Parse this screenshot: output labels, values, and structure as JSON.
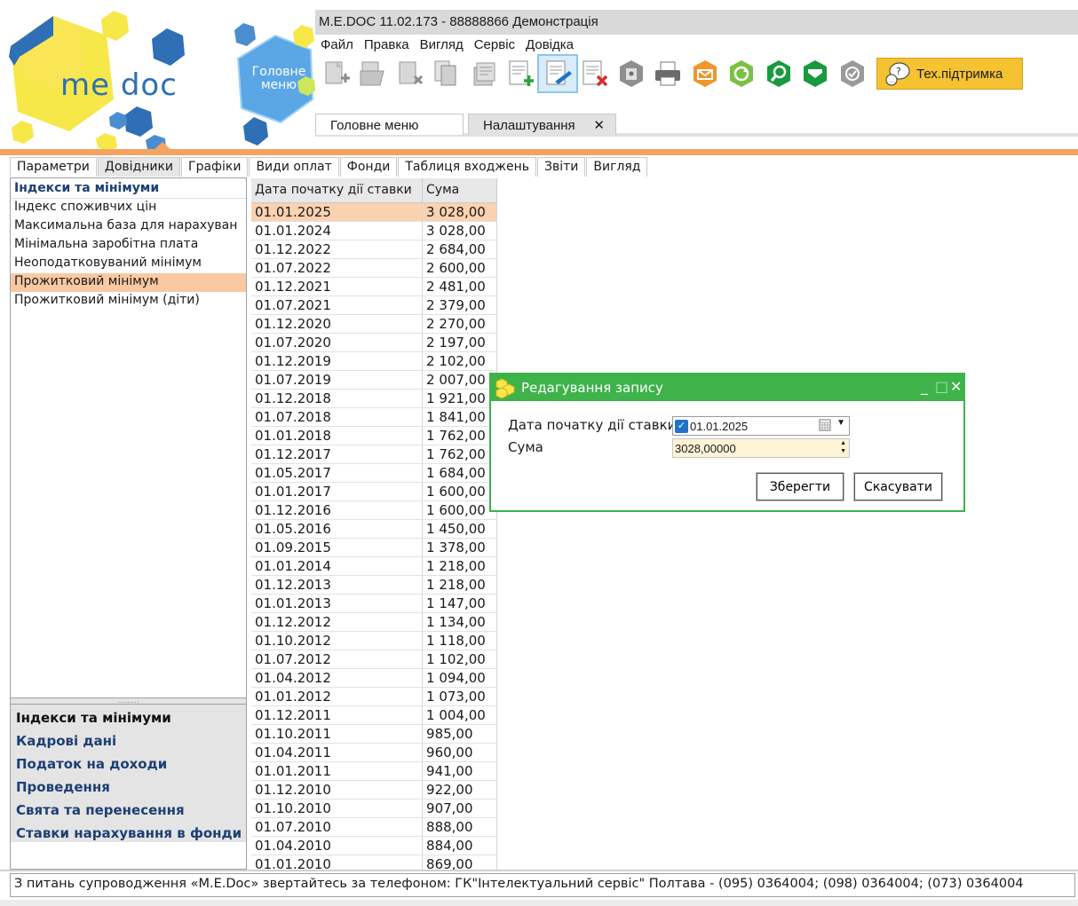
{
  "app": {
    "title": "M.E.DOC 11.02.173  - 88888866 Демонстрація",
    "logo_text": "me doc",
    "main_menu_hex_label": "Головне меню"
  },
  "menu": [
    "Файл",
    "Правка",
    "Вигляд",
    "Сервіс",
    "Довідка"
  ],
  "toolbar": {
    "icons": [
      "new-document-icon",
      "open-document-icon",
      "delete-document-icon",
      "copy-icon",
      "stack-icon",
      "add-record-icon",
      "edit-record-icon",
      "delete-record-icon",
      "archive-icon",
      "print-icon",
      "send-mail-icon",
      "refresh-icon",
      "search-icon",
      "inbox-icon",
      "verify-icon"
    ],
    "support_label": "Тех.підтримка",
    "colors": {
      "support_bg": "#f5c332",
      "active_outline": "#8ec5ea"
    }
  },
  "doc_tabs": {
    "main": "Головне меню",
    "settings": "Налаштування",
    "close_glyph": "✕"
  },
  "ribbon_tabs": [
    "Параметри",
    "Довідники",
    "Графіки",
    "Види оплат",
    "Фонди",
    "Таблиця входжень",
    "Звіти",
    "Вигляд"
  ],
  "left_panel": {
    "header": "Індекси та мінімуми",
    "items": [
      "Індекс споживчих цін",
      "Максимальна база для нарахуван",
      "Мінімальна заробітна плата",
      "Неоподатковуваний мінімум",
      "Прожитковий мінімум",
      "Прожитковий мінімум (діти)"
    ],
    "selected_index": 4,
    "splitter_glyph": "………",
    "nav": [
      "Індекси та мінімуми",
      "Кадрові дані",
      "Податок на доходи",
      "Проведення",
      "Свята та перенесення",
      "Ставки нарахування в фонди"
    ]
  },
  "table": {
    "columns": [
      "Дата початку дії ставки",
      "Сума"
    ],
    "rows": [
      [
        "01.01.2025",
        "3 028,00"
      ],
      [
        "01.01.2024",
        "3 028,00"
      ],
      [
        "01.12.2022",
        "2 684,00"
      ],
      [
        "01.07.2022",
        "2 600,00"
      ],
      [
        "01.12.2021",
        "2 481,00"
      ],
      [
        "01.07.2021",
        "2 379,00"
      ],
      [
        "01.12.2020",
        "2 270,00"
      ],
      [
        "01.07.2020",
        "2 197,00"
      ],
      [
        "01.12.2019",
        "2 102,00"
      ],
      [
        "01.07.2019",
        "2 007,00"
      ],
      [
        "01.12.2018",
        "1 921,00"
      ],
      [
        "01.07.2018",
        "1 841,00"
      ],
      [
        "01.01.2018",
        "1 762,00"
      ],
      [
        "01.12.2017",
        "1 762,00"
      ],
      [
        "01.05.2017",
        "1 684,00"
      ],
      [
        "01.01.2017",
        "1 600,00"
      ],
      [
        "01.12.2016",
        "1 600,00"
      ],
      [
        "01.05.2016",
        "1 450,00"
      ],
      [
        "01.09.2015",
        "1 378,00"
      ],
      [
        "01.01.2014",
        "1 218,00"
      ],
      [
        "01.12.2013",
        "1 218,00"
      ],
      [
        "01.01.2013",
        "1 147,00"
      ],
      [
        "01.12.2012",
        "1 134,00"
      ],
      [
        "01.10.2012",
        "1 118,00"
      ],
      [
        "01.07.2012",
        "1 102,00"
      ],
      [
        "01.04.2012",
        "1 094,00"
      ],
      [
        "01.01.2012",
        "1 073,00"
      ],
      [
        "01.12.2011",
        "1 004,00"
      ],
      [
        "01.10.2011",
        "985,00"
      ],
      [
        "01.04.2011",
        "960,00"
      ],
      [
        "01.01.2011",
        "941,00"
      ],
      [
        "01.12.2010",
        "922,00"
      ],
      [
        "01.10.2010",
        "907,00"
      ],
      [
        "01.07.2010",
        "888,00"
      ],
      [
        "01.04.2010",
        "884,00"
      ],
      [
        "01.01.2010",
        "869,00"
      ]
    ],
    "selected_index": 0
  },
  "dialog": {
    "title": "Редагування запису",
    "date_label": "Дата початку дії ставки",
    "date_value": "01.01.2025",
    "sum_label": "Сума",
    "sum_value": "3028,00000",
    "save_label": "Зберегти",
    "cancel_label": "Скасувати",
    "minimize_glyph": "_",
    "maximize_glyph": "□",
    "close_glyph": "✕",
    "colors": {
      "frame": "#3db34a"
    }
  },
  "status_bar": "З питань супроводження «M.E.Doc» звертайтесь за телефоном: ГК\"Інтелектуальний сервіс\" Полтава - (095) 0364004;  (098) 0364004;  (073) 0364004"
}
